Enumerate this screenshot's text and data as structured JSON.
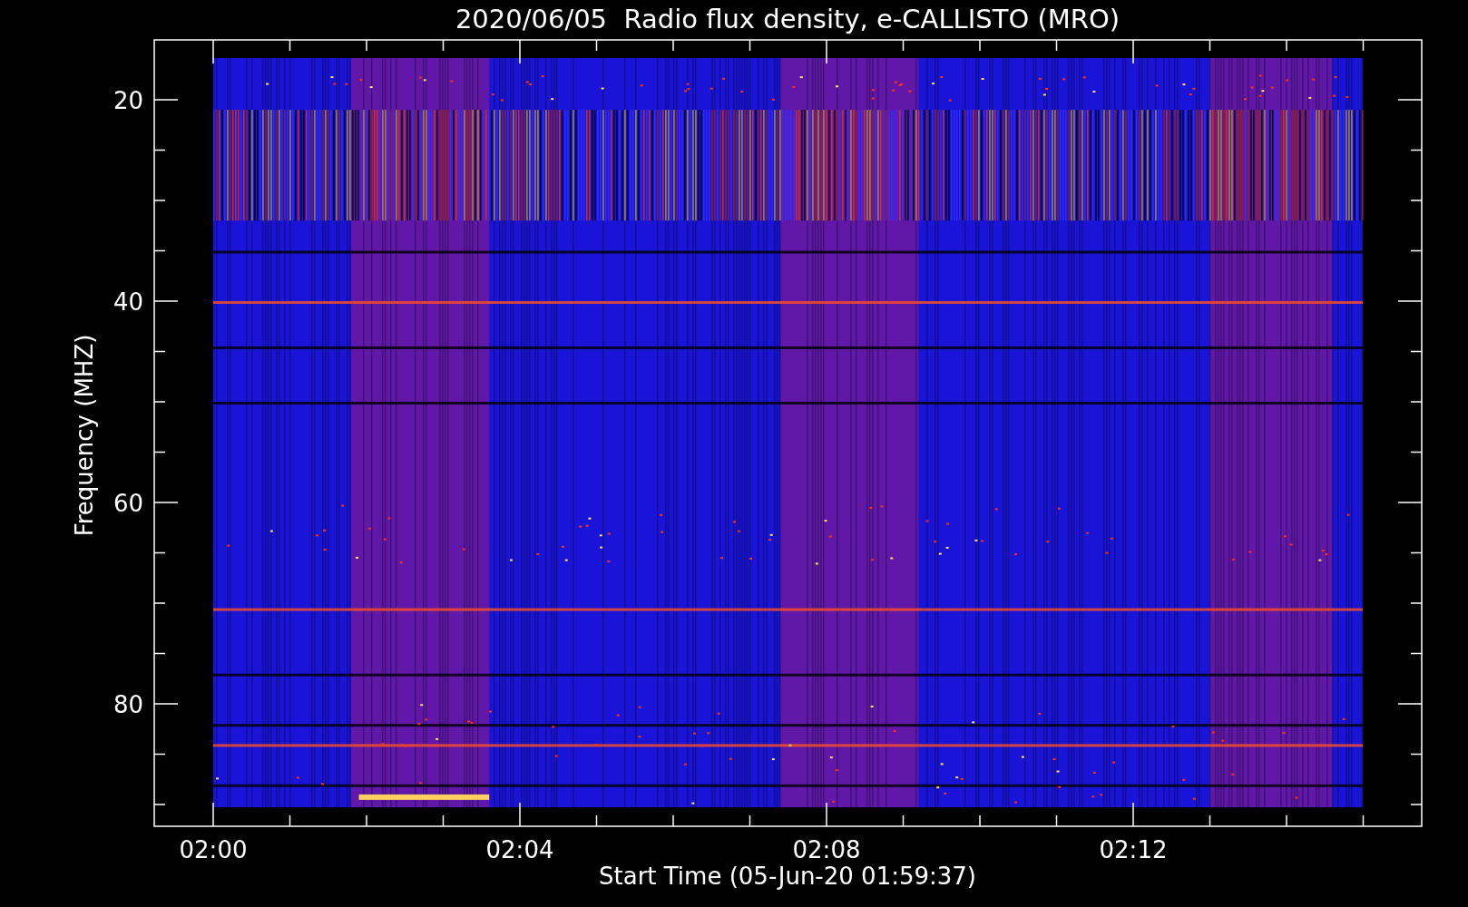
{
  "title": "2020/06/05  Radio flux density, e-CALLISTO (MRO)",
  "y_axis": {
    "label": "Frequency (MHZ)",
    "ticks": [
      "20",
      "40",
      "60",
      "80"
    ]
  },
  "x_axis": {
    "label": "Start Time (05-Jun-20 01:59:37)",
    "ticks": [
      "02:00",
      "02:04",
      "02:08",
      "02:12"
    ]
  }
}
